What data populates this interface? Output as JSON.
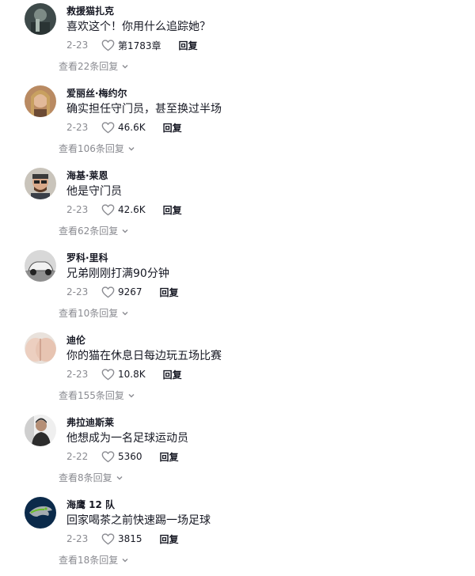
{
  "comments": [
    {
      "name": "救援猫扎克",
      "text": "喜欢这个！你用什么追踪她？",
      "date": "2-23",
      "likes": "第1783章",
      "reply": "回复",
      "view_replies": "查看22条回复"
    },
    {
      "name": "爱丽丝·梅约尔",
      "text": "确实担任守门员，甚至换过半场",
      "date": "2-23",
      "likes": "46.6K",
      "reply": "回复",
      "view_replies": "查看106条回复"
    },
    {
      "name": "海基·莱恩",
      "text": "他是守门员",
      "date": "2-23",
      "likes": "42.6K",
      "reply": "回复",
      "view_replies": "查看62条回复"
    },
    {
      "name": "罗科·里科",
      "text": "兄弟刚刚打满90分钟",
      "date": "2-23",
      "likes": "9267",
      "reply": "回复",
      "view_replies": "查看10条回复"
    },
    {
      "name": "迪伦",
      "text": "你的猫在休息日每边玩五场比赛",
      "date": "2-23",
      "likes": "10.8K",
      "reply": "回复",
      "view_replies": "查看155条回复"
    },
    {
      "name": "弗拉迪斯莱",
      "text": "他想成为一名足球运动员",
      "date": "2-22",
      "likes": "5360",
      "reply": "回复",
      "view_replies": "查看8条回复"
    },
    {
      "name": "海鹰 12 队",
      "text": "回家喝茶之前快速踢一场足球",
      "date": "2-23",
      "likes": "3815",
      "reply": "回复",
      "view_replies": "查看18条回复"
    }
  ],
  "colors": {
    "text": "#161823",
    "muted": "#8a8b91",
    "seahawks_navy": "#0b2a4a",
    "seahawks_green": "#69be28"
  },
  "icons": {
    "like": "heart-outline-icon",
    "expand": "chevron-down-icon"
  }
}
